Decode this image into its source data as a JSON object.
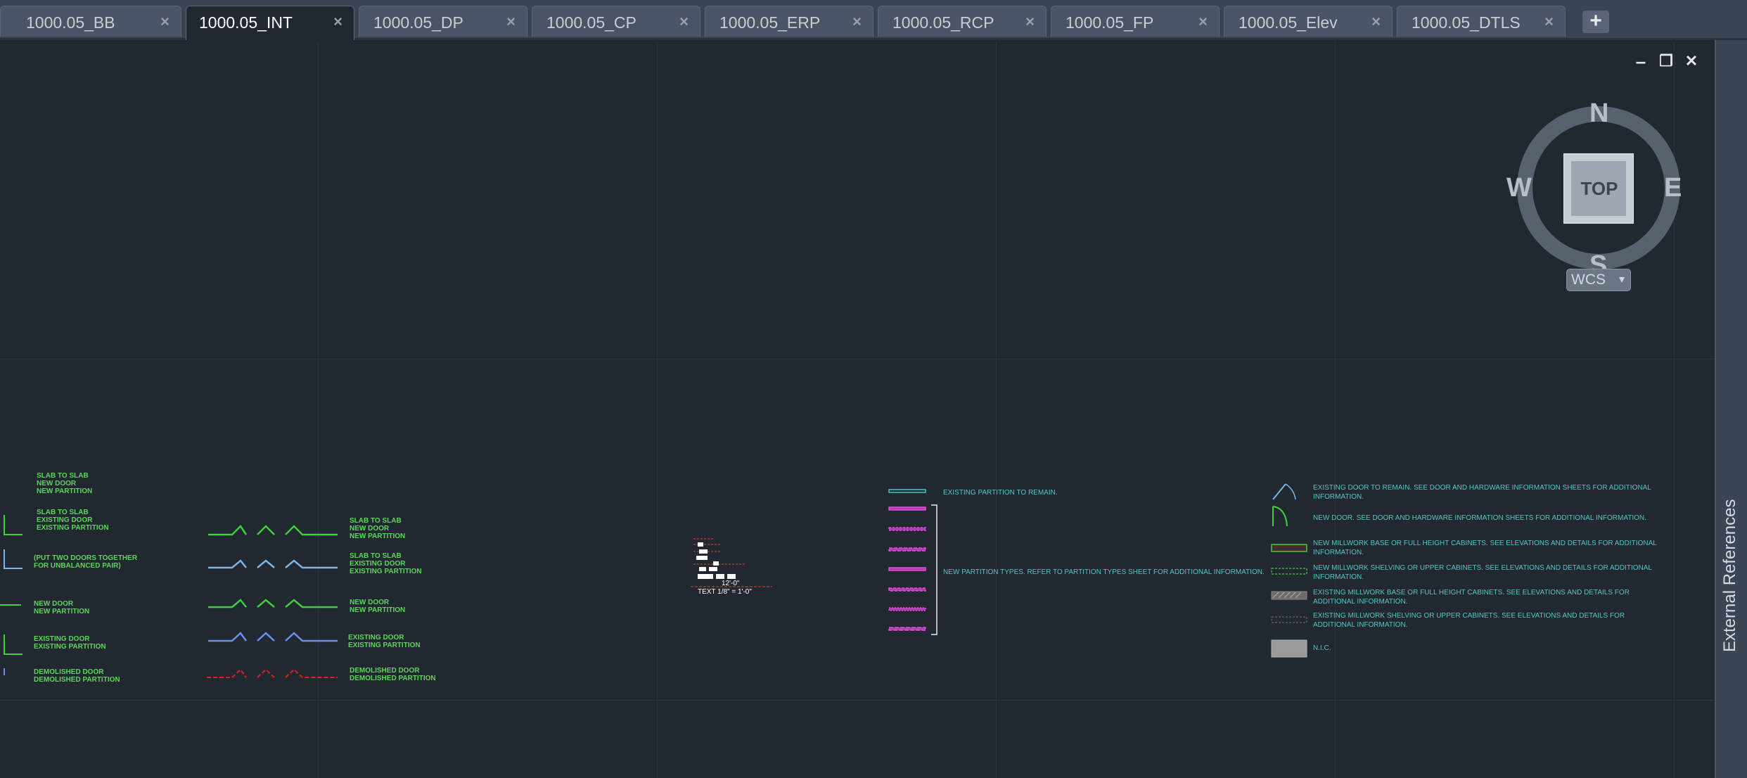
{
  "tabs": [
    {
      "label": "1000.05_BB",
      "active": false
    },
    {
      "label": "1000.05_INT",
      "active": true
    },
    {
      "label": "1000.05_DP",
      "active": false
    },
    {
      "label": "1000.05_CP",
      "active": false
    },
    {
      "label": "1000.05_ERP",
      "active": false
    },
    {
      "label": "1000.05_RCP",
      "active": false
    },
    {
      "label": "1000.05_FP",
      "active": false
    },
    {
      "label": "1000.05_Elev",
      "active": false
    },
    {
      "label": "1000.05_DTLS",
      "active": false
    }
  ],
  "new_tab_label": "+",
  "window_controls": {
    "minimize": "–",
    "restore": "❐",
    "close": "✕"
  },
  "viewcube": {
    "north": "N",
    "south": "S",
    "east": "E",
    "west": "W",
    "face": "TOP"
  },
  "wcs": {
    "label": "WCS",
    "caret": "▾"
  },
  "side_panel": {
    "label": "External References"
  },
  "drawing": {
    "left_labels": [
      [
        "SLAB TO SLAB",
        "NEW DOOR",
        "NEW PARTITION"
      ],
      [
        "SLAB TO SLAB",
        "EXISTING DOOR",
        "EXISTING PARTITION"
      ],
      [
        "(PUT TWO DOORS TOGETHER",
        "FOR UNBALANCED PAIR)"
      ],
      [
        "NEW DOOR",
        "NEW PARTITION"
      ],
      [
        "EXISTING DOOR",
        "EXISTING PARTITION"
      ],
      [
        "DEMOLISHED DOOR",
        "DEMOLISHED PARTITION"
      ]
    ],
    "mid_labels": [
      [
        "SLAB TO SLAB",
        "NEW DOOR",
        "NEW PARTITION"
      ],
      [
        "SLAB TO SLAB",
        "EXISTING DOOR",
        "EXISTING PARTITION"
      ],
      [
        "NEW DOOR",
        "NEW PARTITION"
      ],
      [
        "EXISTING DOOR",
        "EXISTING PARTITION"
      ],
      [
        "DEMOLISHED DOOR",
        "DEMOLISHED PARTITION"
      ]
    ],
    "scale_dimension": "12'-0\"",
    "scale_text": "TEXT 1/8\" = 1'-0\"",
    "partition_existing": "EXISTING PARTITION TO REMAIN.",
    "partition_new": "NEW  PARTITION TYPES. REFER TO PARTITION TYPES SHEET FOR ADDITIONAL INFORMATION.",
    "legend": [
      {
        "line1": "EXISTING DOOR TO REMAIN. SEE DOOR AND HARDWARE INFORMATION SHEETS FOR ADDITIONAL",
        "line2": "INFORMATION."
      },
      {
        "line1": "NEW DOOR. SEE DOOR AND HARDWARE INFORMATION SHEETS FOR ADDITIONAL INFORMATION.",
        "line2": ""
      },
      {
        "line1": "NEW MILLWORK BASE OR FULL HEIGHT CABINETS. SEE ELEVATIONS AND DETAILS FOR ADDITIONAL",
        "line2": "INFORMATION."
      },
      {
        "line1": "NEW MILLWORK SHELVING OR UPPER CABINETS. SEE ELEVATIONS AND DETAILS FOR ADDITIONAL",
        "line2": "INFORMATION."
      },
      {
        "line1": "EXISTING MILLWORK BASE OR FULL HEIGHT CABINETS. SEE ELEVATIONS AND DETAILS FOR",
        "line2": "ADDITIONAL INFORMATION."
      },
      {
        "line1": "EXISTING MILLWORK SHELVING OR UPPER CABINETS. SEE ELEVATIONS AND DETAILS FOR",
        "line2": "ADDITIONAL INFORMATION."
      },
      {
        "line1": "N.I.C.",
        "line2": ""
      }
    ]
  }
}
